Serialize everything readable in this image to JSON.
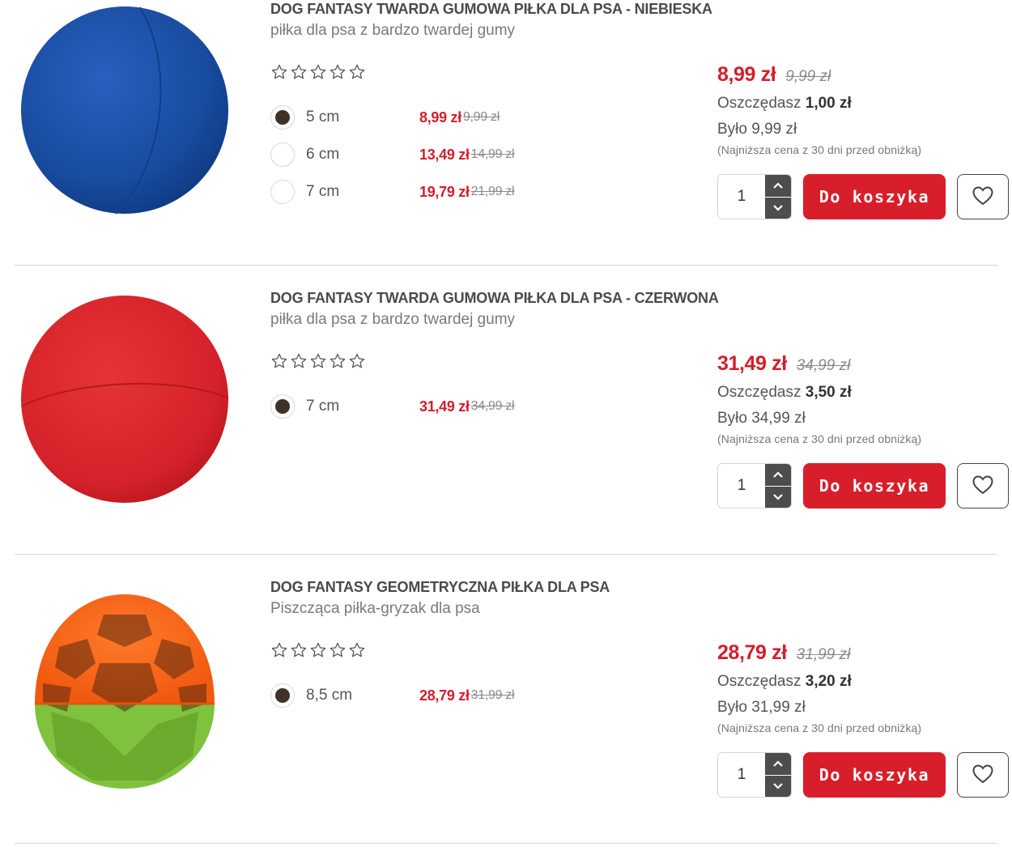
{
  "products": [
    {
      "image": "blue-rubber-ball",
      "title": "DOG FANTASY TWARDA GUMOWA PIŁKA DLA PSA - NIEBIESKA",
      "subtitle": "piłka dla psa z bardzo twardej gumy",
      "rating": 0,
      "variants": [
        {
          "size": "5 cm",
          "price": "8,99 zł",
          "old_price": "9,99 zł",
          "selected": true
        },
        {
          "size": "6 cm",
          "price": "13,49 zł",
          "old_price": "14,99 zł",
          "selected": false
        },
        {
          "size": "7 cm",
          "price": "19,79 zł",
          "old_price": "21,99 zł",
          "selected": false
        }
      ],
      "price": "8,99 zł",
      "old_price": "9,99 zł",
      "save_label": "Oszczędasz",
      "save_amount": "1,00 zł",
      "was": "Było 9,99 zł",
      "lowest": "(Najniższa cena z 30 dni przed obniżką)",
      "quantity": "1",
      "cart_label": "Do koszyka"
    },
    {
      "image": "red-rubber-ball",
      "title": "DOG FANTASY TWARDA GUMOWA PIŁKA DLA PSA - CZERWONA",
      "subtitle": "piłka dla psa z bardzo twardej gumy",
      "rating": 0,
      "variants": [
        {
          "size": "7 cm",
          "price": "31,49 zł",
          "old_price": "34,99 zł",
          "selected": true
        }
      ],
      "price": "31,49 zł",
      "old_price": "34,99 zł",
      "save_label": "Oszczędasz",
      "save_amount": "3,50 zł",
      "was": "Było 34,99 zł",
      "lowest": "(Najniższa cena z 30 dni przed obniżką)",
      "quantity": "1",
      "cart_label": "Do koszyka"
    },
    {
      "image": "geometric-ball",
      "title": "DOG FANTASY GEOMETRYCZNA PIŁKA DLA PSA",
      "subtitle": "Piszcząca piłka-gryzak dla psa",
      "rating": 0,
      "variants": [
        {
          "size": "8,5 cm",
          "price": "28,79 zł",
          "old_price": "31,99 zł",
          "selected": true
        }
      ],
      "price": "28,79 zł",
      "old_price": "31,99 zł",
      "save_label": "Oszczędasz",
      "save_amount": "3,20 zł",
      "was": "Było 31,99 zł",
      "lowest": "(Najniższa cena z 30 dni przed obniżką)",
      "quantity": "1",
      "cart_label": "Do koszyka"
    }
  ],
  "colors": {
    "price_red": "#d31f2b",
    "button_red": "#d81e2a",
    "radio_dot": "#3e3226",
    "stepper": "#4d4d4d"
  },
  "icons": {
    "star": "star-outline-icon",
    "heart": "heart-outline-icon",
    "up": "chevron-up-icon",
    "down": "chevron-down-icon"
  }
}
